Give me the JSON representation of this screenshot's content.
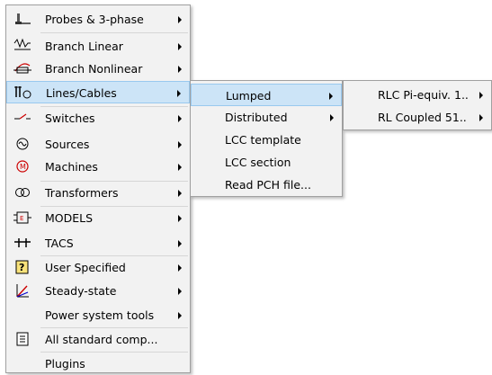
{
  "menu1": {
    "items": [
      {
        "label": "Probes & 3-phase",
        "icon": "probe-icon",
        "submenu": true
      },
      {
        "label": "Branch Linear",
        "icon": "branch-linear-icon",
        "submenu": true
      },
      {
        "label": "Branch Nonlinear",
        "icon": "branch-nonlinear-icon",
        "submenu": true
      },
      {
        "label": "Lines/Cables",
        "icon": "lines-cables-icon",
        "submenu": true,
        "highlighted": true
      },
      {
        "label": "Switches",
        "icon": "switch-icon",
        "submenu": true
      },
      {
        "label": "Sources",
        "icon": "source-icon",
        "submenu": true
      },
      {
        "label": "Machines",
        "icon": "machine-icon",
        "submenu": true
      },
      {
        "label": "Transformers",
        "icon": "transformer-icon",
        "submenu": true
      },
      {
        "label": "MODELS",
        "icon": "models-icon",
        "submenu": true
      },
      {
        "label": "TACS",
        "icon": "tacs-icon",
        "submenu": true
      },
      {
        "label": "User Specified",
        "icon": "user-specified-icon",
        "submenu": true
      },
      {
        "label": "Steady-state",
        "icon": "steady-state-icon",
        "submenu": true
      },
      {
        "label": "Power system tools",
        "icon": "",
        "submenu": true
      },
      {
        "label": "All standard comp...",
        "icon": "all-standard-icon",
        "submenu": false
      },
      {
        "label": "Plugins",
        "icon": "",
        "submenu": false
      }
    ]
  },
  "menu2": {
    "items": [
      {
        "label": "Lumped",
        "submenu": true,
        "highlighted": true
      },
      {
        "label": "Distributed",
        "submenu": true
      },
      {
        "label": "LCC template",
        "submenu": false
      },
      {
        "label": "LCC section",
        "submenu": false
      },
      {
        "label": "Read PCH file...",
        "submenu": false
      }
    ]
  },
  "menu3": {
    "items": [
      {
        "label": "RLC Pi-equiv. 1..",
        "submenu": true
      },
      {
        "label": "RL Coupled 51..",
        "submenu": true
      }
    ]
  },
  "colors": {
    "menu_bg": "#f2f2f2",
    "highlight": "#cce4f7",
    "highlight_border": "#99c9ef"
  }
}
